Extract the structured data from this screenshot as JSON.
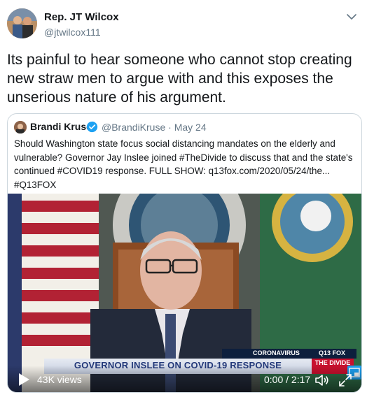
{
  "author": {
    "name": "Rep. JT Wilcox",
    "handle": "@jtwilcox111"
  },
  "tweet": {
    "text": "Its painful to hear someone who cannot stop creating new straw men to argue with and this exposes the unserious nature of his argument."
  },
  "quote": {
    "name": "Brandi Kruse",
    "handle_date": "@BrandiKruse · May 24",
    "text": "Should Washington state focus social distancing mandates on the elderly and vulnerable? Governor Jay Inslee joined #TheDivide to discuss that and the state's continued #COVID19 response. FULL SHOW: q13fox.com/2020/05/24/the... #Q13FOX",
    "verified": true
  },
  "video": {
    "lower_third": "GOVERNOR INSLEE ON COVID-19 RESPONSE",
    "topic": "CORONAVIRUS",
    "station": "Q13 FOX",
    "show_logo": "THE DIVIDE",
    "views": "43K views",
    "time": "0:00 / 2:17"
  },
  "colors": {
    "accent": "#1da1f2",
    "text": "#14171a",
    "secondary": "#657786",
    "border": "#ccd6dd",
    "show_red": "#c8102e"
  },
  "icons": [
    "chevron-down-icon",
    "verified-badge-icon",
    "play-icon",
    "volume-icon",
    "fullscreen-icon",
    "picture-in-picture-icon"
  ]
}
